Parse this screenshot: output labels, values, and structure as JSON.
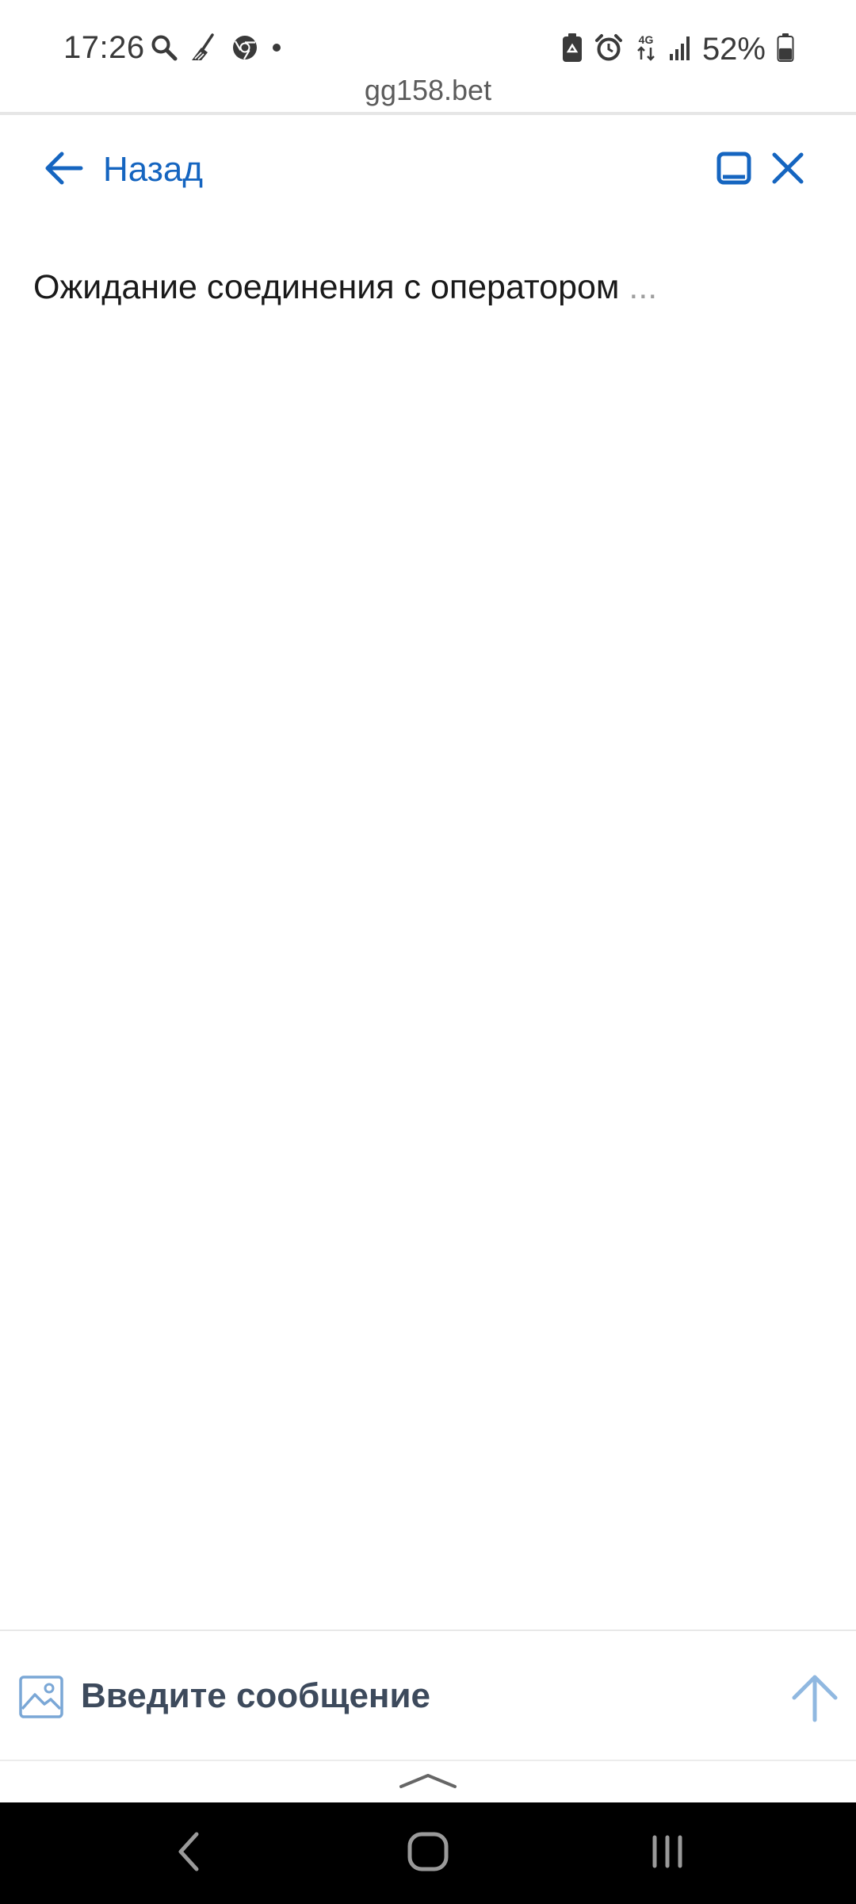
{
  "status_bar": {
    "time": "17:26",
    "left_icons": [
      "search-icon",
      "broom-icon",
      "chrome-icon",
      "notification-dot-icon"
    ],
    "right_icons": [
      "battery-saver-icon",
      "alarm-icon",
      "network-4g-icon",
      "signal-icon"
    ],
    "network_label": "4G",
    "battery_percent": "52%",
    "battery_level": 0.52
  },
  "browser": {
    "url": "gg158.bet"
  },
  "header": {
    "back_label": "Назад",
    "accent_color": "#1565c0"
  },
  "chat": {
    "waiting_message": "Ожидание соединения с оператором",
    "waiting_dots": " ..."
  },
  "composer": {
    "placeholder": "Введите сообщение",
    "value": ""
  },
  "colors": {
    "accent": "#1565c0",
    "send_disabled": "#90b8e0",
    "text": "#1a1a1a"
  }
}
